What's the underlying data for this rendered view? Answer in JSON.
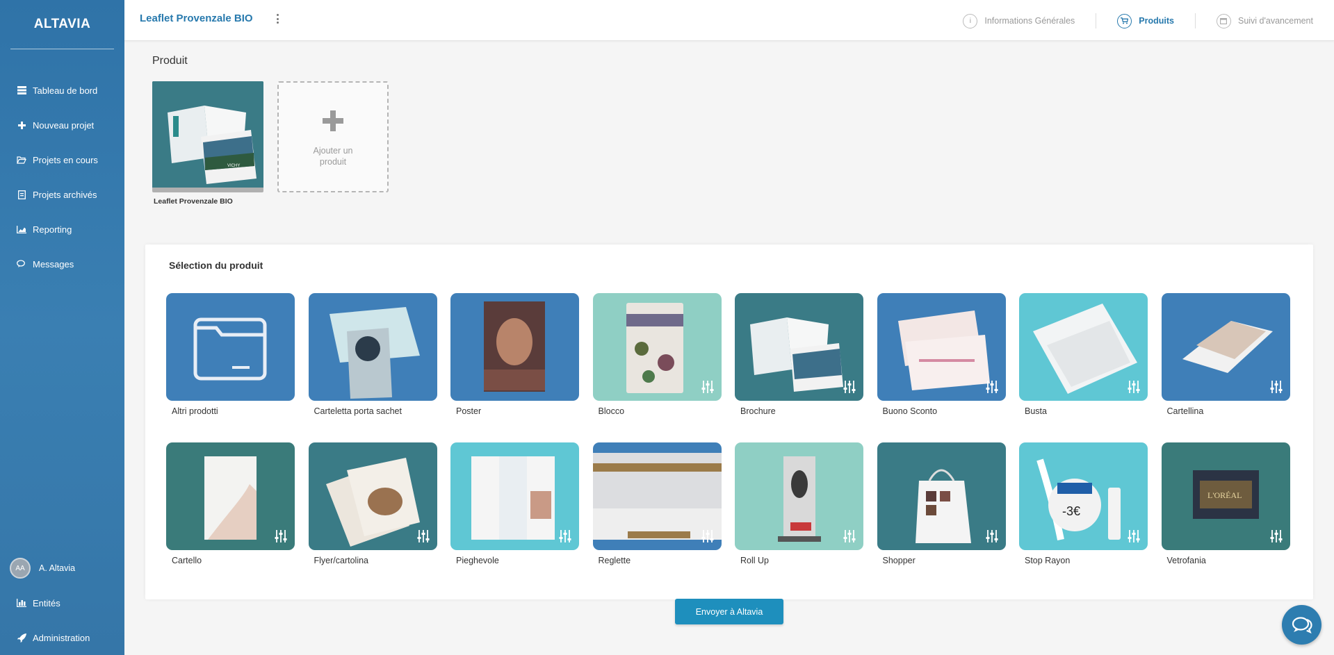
{
  "sidebar": {
    "logo": "ALTAVIA",
    "items": [
      {
        "label": "Tableau de bord",
        "icon": "dashboard-icon"
      },
      {
        "label": "Nouveau projet",
        "icon": "plus-icon"
      },
      {
        "label": "Projets en cours",
        "icon": "folder-open-icon"
      },
      {
        "label": "Projets archivés",
        "icon": "archive-file-icon"
      },
      {
        "label": "Reporting",
        "icon": "area-chart-icon"
      },
      {
        "label": "Messages",
        "icon": "chat-icon"
      }
    ],
    "user": {
      "initials": "AA",
      "name": "A. Altavia"
    },
    "bottom_items": [
      {
        "label": "Entités",
        "icon": "bar-chart-icon"
      },
      {
        "label": "Administration",
        "icon": "rocket-icon"
      }
    ]
  },
  "header": {
    "project_title": "Leaflet Provenzale BIO",
    "tabs": [
      {
        "label": "Informations Générales",
        "icon": "info-icon",
        "active": false
      },
      {
        "label": "Produits",
        "icon": "cart-icon",
        "active": true
      },
      {
        "label": "Suivi d'avancement",
        "icon": "calendar-icon",
        "active": false
      }
    ]
  },
  "product_section": {
    "label": "Produit",
    "current_product": "Leaflet Provenzale BIO",
    "add_label": "Ajouter un produit"
  },
  "selection": {
    "title": "Sélection du produit",
    "tiles": [
      {
        "label": "Altri prodotti",
        "bg": "#3f7fb8",
        "configurable": false
      },
      {
        "label": "Carteletta porta sachet",
        "bg": "#3f7fb8",
        "configurable": false
      },
      {
        "label": "Poster",
        "bg": "#3f7fb8",
        "configurable": false
      },
      {
        "label": "Blocco",
        "bg": "#8fcfc4",
        "configurable": true
      },
      {
        "label": "Brochure",
        "bg": "#3a7b86",
        "configurable": true
      },
      {
        "label": "Buono Sconto",
        "bg": "#3f7fb8",
        "configurable": true
      },
      {
        "label": "Busta",
        "bg": "#5fc7d4",
        "configurable": true
      },
      {
        "label": "Cartellina",
        "bg": "#3f7fb8",
        "configurable": true
      },
      {
        "label": "Cartello",
        "bg": "#3a7b7a",
        "configurable": true
      },
      {
        "label": "Flyer/cartolina",
        "bg": "#3a7b86",
        "configurable": true
      },
      {
        "label": "Pieghevole",
        "bg": "#5fc7d4",
        "configurable": true
      },
      {
        "label": "Reglette",
        "bg": "#3f7fb8",
        "configurable": true
      },
      {
        "label": "Roll Up",
        "bg": "#8fcfc4",
        "configurable": true
      },
      {
        "label": "Shopper",
        "bg": "#3a7b86",
        "configurable": true
      },
      {
        "label": "Stop Rayon",
        "bg": "#5fc7d4",
        "configurable": true
      },
      {
        "label": "Vetrofania",
        "bg": "#3a7b7a",
        "configurable": true
      }
    ]
  },
  "send_button": "Envoyer à Altavia",
  "colors": {
    "brand": "#2779ad",
    "sidebar": "#3479ae",
    "button": "#1e8fbd"
  }
}
